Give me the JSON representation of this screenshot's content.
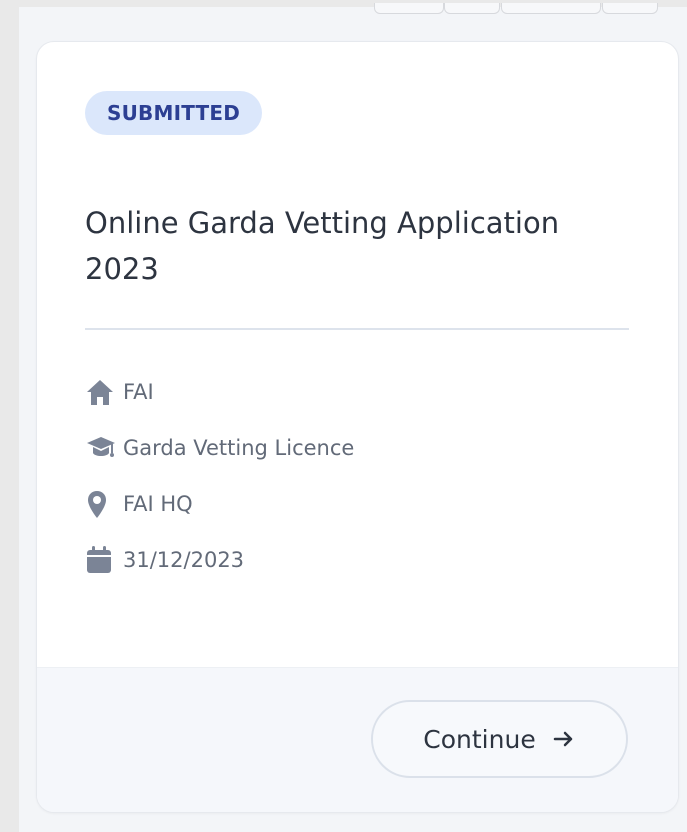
{
  "card": {
    "status": "SUBMITTED",
    "title": "Online Garda Vetting Application 2023",
    "details": {
      "organisation": "FAI",
      "licence": "Garda Vetting Licence",
      "location": "FAI HQ",
      "date": "31/12/2023"
    },
    "action": {
      "label": "Continue"
    }
  },
  "icons": {
    "organisation": "house-icon",
    "licence": "graduation-cap-icon",
    "location": "map-pin-icon",
    "date": "calendar-icon",
    "action": "arrow-right-icon"
  },
  "colors": {
    "badge_bg": "#dbe7fb",
    "badge_text": "#2c3f93",
    "icon": "#7b8496",
    "text": "#626a78"
  }
}
